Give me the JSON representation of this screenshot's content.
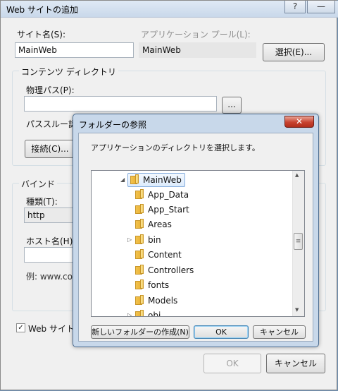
{
  "main_dialog": {
    "title": "Web サイトの追加",
    "help_button": "?",
    "minimize_button": "—",
    "site_name": {
      "label": "サイト名(S):",
      "value": "MainWeb"
    },
    "app_pool": {
      "label": "アプリケーション プール(L):",
      "value": "MainWeb"
    },
    "select_button": "選択(E)...",
    "content_directory": {
      "group_title": "コンテンツ ディレクトリ",
      "physical_path_label": "物理パス(P):",
      "physical_path_value": "",
      "browse_button": "...",
      "pass_through_label": "パススルー認証",
      "connect_button": "接続(C)..."
    },
    "binding": {
      "group_title": "バインド",
      "type_label": "種類(T):",
      "type_value": "http",
      "host_label": "ホスト名(H):",
      "host_value": "",
      "example_text": "例: www.con"
    },
    "start_website_checkbox": {
      "label": "Web サイトを",
      "checked_mark": "✓"
    },
    "ok_button": "OK",
    "cancel_button": "キャンセル"
  },
  "folder_dialog": {
    "title": "フォルダーの参照",
    "close_button": "✕",
    "instruction": "アプリケーションのディレクトリを選択します。",
    "tree": [
      {
        "label": "MainWeb",
        "expander": "◢",
        "selected": true
      },
      {
        "label": "App_Data",
        "expander": ""
      },
      {
        "label": "App_Start",
        "expander": ""
      },
      {
        "label": "Areas",
        "expander": ""
      },
      {
        "label": "bin",
        "expander": "▷"
      },
      {
        "label": "Content",
        "expander": ""
      },
      {
        "label": "Controllers",
        "expander": ""
      },
      {
        "label": "fonts",
        "expander": ""
      },
      {
        "label": "Models",
        "expander": ""
      },
      {
        "label": "obj",
        "expander": "▷"
      }
    ],
    "scroll_up": "▲",
    "scroll_down": "▼",
    "scroll_grip": "≡",
    "new_folder_button": "新しいフォルダーの作成(N)",
    "ok_button": "OK",
    "cancel_button": "キャンセル"
  }
}
